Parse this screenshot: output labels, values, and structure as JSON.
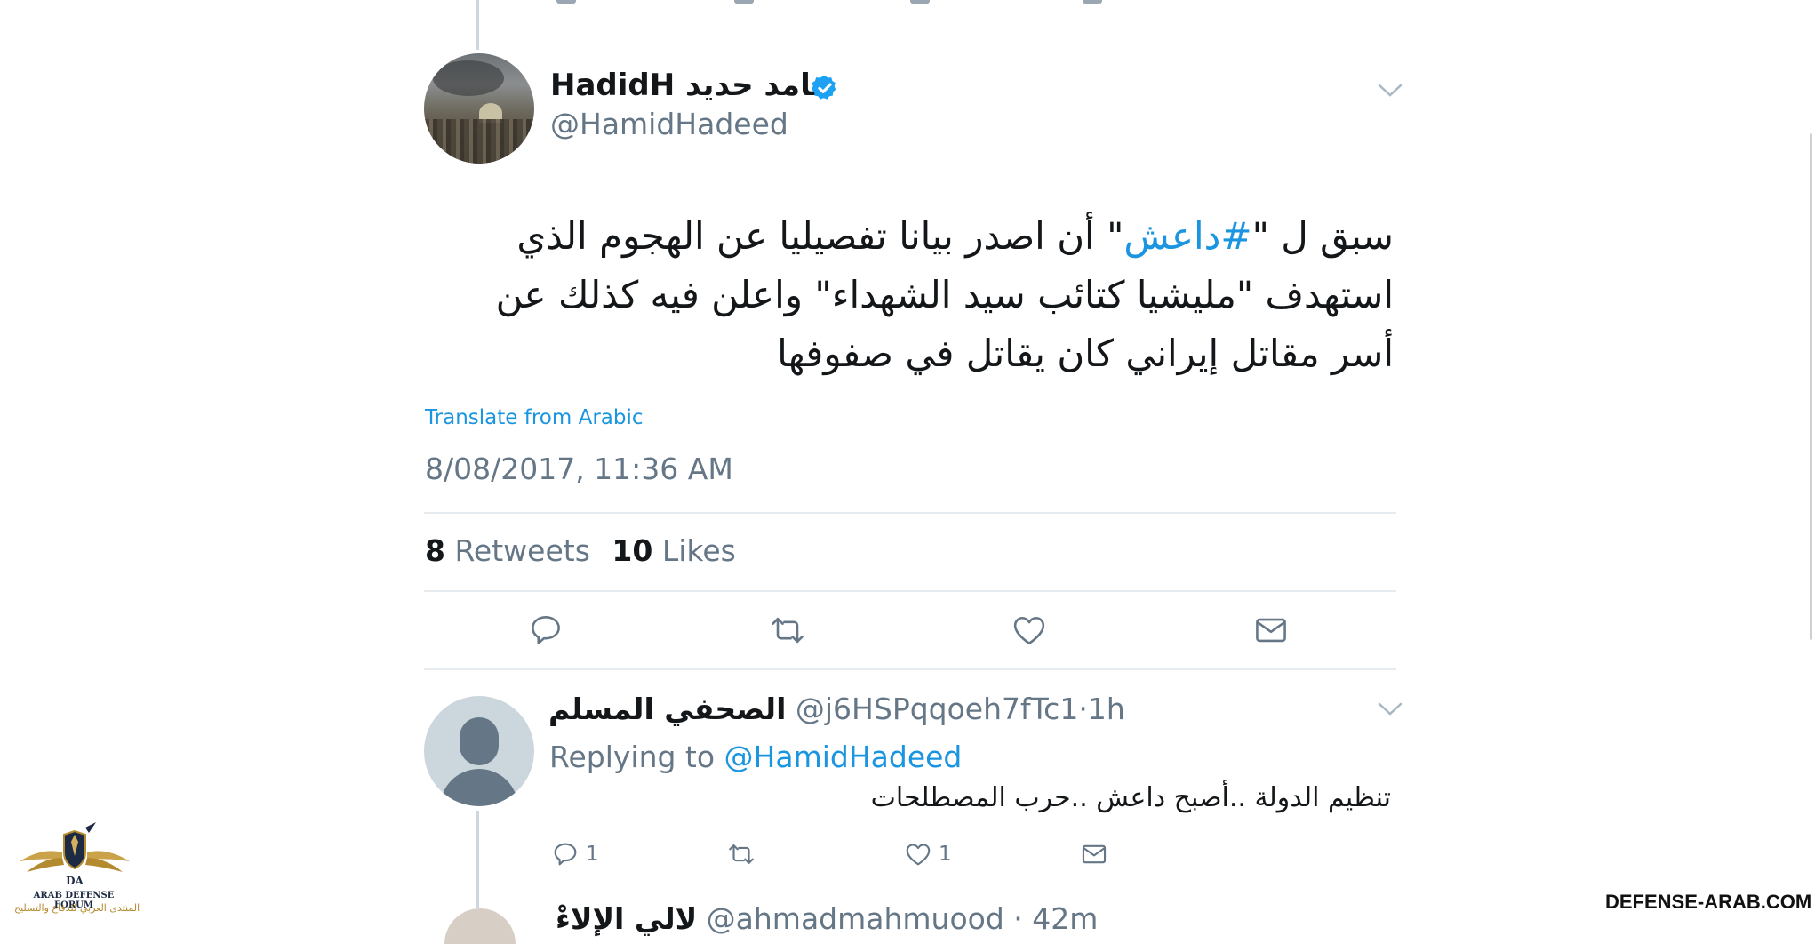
{
  "tweet": {
    "display_name": "HadidH  حامد حديد",
    "handle": "@HamidHadeed",
    "text_before": "سبق ل \"",
    "hashtag": "#داعش",
    "text_after": "\" أن اصدر بيانا تفصيليا عن الهجوم الذي استهدف \"مليشيا كتائب سيد الشهداء\" واعلن فيه كذلك عن أسر مقاتل إيراني كان يقاتل في صفوفها",
    "translate_label": "Translate from Arabic",
    "timestamp": "8/08/2017, 11:36 AM",
    "retweets_count": "8",
    "retweets_label": "Retweets",
    "likes_count": "10",
    "likes_label": "Likes"
  },
  "reply": {
    "display_name": "الصحفي المسلم",
    "handle": "@j6HSPqqoeh7fTc1",
    "separator": "·",
    "time": "1h",
    "replying_prefix": "Replying to",
    "replying_mention": "@HamidHadeed",
    "text": "تنظيم الدولة ..أصبح داعش ..حرب المصطلحات",
    "reply_count": "1",
    "like_count": "1"
  },
  "next_reply": {
    "display_name": "لالي الإلاءْ",
    "handle": "@ahmadmahmuood · 42m"
  },
  "watermark": {
    "logo_title": "ARAB DEFENSE FORUM",
    "logo_arabic": "المنتدى العربي للدفاع والتسليح",
    "site": "DEFENSE-ARAB.COM"
  },
  "icons": {
    "verified": "verified-badge-icon",
    "caret": "chevron-down-icon",
    "reply": "reply-icon",
    "retweet": "retweet-icon",
    "like": "heart-icon",
    "message": "envelope-icon"
  },
  "colors": {
    "link": "#1b95e0",
    "secondary_text": "#657786",
    "divider": "#e6ecf0"
  }
}
